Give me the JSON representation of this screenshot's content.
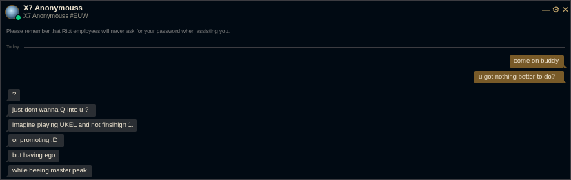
{
  "header": {
    "name": "X7 Anonymouss",
    "tag": "X7 Anonymouss #EUW",
    "minimize_glyph": "—",
    "settings_glyph": "⚙",
    "close_glyph": "✕"
  },
  "notice": "Please remember that Riot employees will never ask for your password when assisting you.",
  "day_separator": "Today",
  "messages": [
    {
      "side": "sent",
      "text": "come on buddy"
    },
    {
      "side": "sent",
      "text": "u got nothing better to do?"
    },
    {
      "side": "recv",
      "text": "?"
    },
    {
      "side": "recv",
      "text": "just dont wanna Q into u ?"
    },
    {
      "side": "recv",
      "text": "imagine playing UKEL and not finsihign 1."
    },
    {
      "side": "recv",
      "text": "or promoting :D"
    },
    {
      "side": "recv",
      "text": "but having ego"
    },
    {
      "side": "recv",
      "text": "while beeing master peak"
    }
  ],
  "colors": {
    "background": "#010a13",
    "gold": "#c8aa6e",
    "sent_bubble": "#785a28",
    "received_bubble": "#2a2e33",
    "online_status": "#0acf83"
  }
}
